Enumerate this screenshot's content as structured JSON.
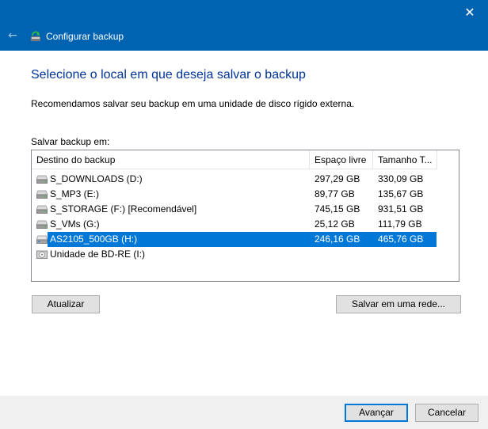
{
  "window": {
    "title": "Configurar backup",
    "close_glyph": "✕",
    "back_glyph": "←",
    "accent_color": "#0063b1"
  },
  "page": {
    "heading": "Selecione o local em que deseja salvar o backup",
    "recommendation": "Recomendamos salvar seu backup em uma unidade de disco rígido externa.",
    "save_label": "Salvar backup em:"
  },
  "table": {
    "columns": [
      "Destino do backup",
      "Espaço livre",
      "Tamanho T..."
    ],
    "rows": [
      {
        "name": "S_DOWNLOADS (D:)",
        "free": "297,29 GB",
        "total": "330,09 GB",
        "icon": "hard-drive-icon",
        "selected": false
      },
      {
        "name": "S_MP3 (E:)",
        "free": "89,77 GB",
        "total": "135,67 GB",
        "icon": "hard-drive-icon",
        "selected": false
      },
      {
        "name": "S_STORAGE (F:) [Recomendável]",
        "free": "745,15 GB",
        "total": "931,51 GB",
        "icon": "hard-drive-icon",
        "selected": false
      },
      {
        "name": "S_VMs (G:)",
        "free": "25,12 GB",
        "total": "111,79 GB",
        "icon": "hard-drive-icon",
        "selected": false
      },
      {
        "name": "AS2105_500GB (H:)",
        "free": "246,16 GB",
        "total": "465,76 GB",
        "icon": "external-drive-icon",
        "selected": true
      },
      {
        "name": "Unidade de BD-RE (I:)",
        "free": "",
        "total": "",
        "icon": "optical-drive-icon",
        "selected": false
      }
    ]
  },
  "buttons": {
    "refresh": "Atualizar",
    "save_network": "Salvar em uma rede...",
    "next": "Avançar",
    "cancel": "Cancelar"
  }
}
